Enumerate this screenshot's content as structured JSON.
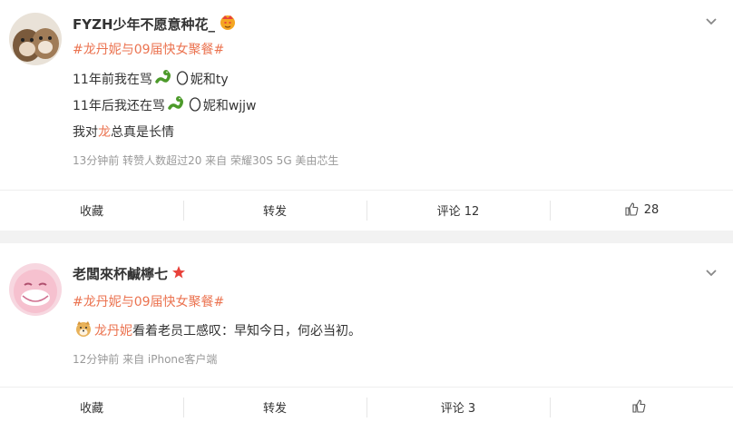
{
  "posts": [
    {
      "username": "FYZH少年不愿意种花_",
      "badge_icon": "crown-emoji-icon",
      "topic": "#龙丹妮与09届快女聚餐#",
      "lines": {
        "l1_a": "11年前我在骂",
        "l1_b": "妮和ty",
        "l2_a": "11年后我还在骂",
        "l2_b": "妮和wjjw",
        "l3_a": "我对",
        "l3_hl": "龙",
        "l3_b": "总真是长情"
      },
      "meta": "13分钟前  转赞人数超过20  来自 荣耀30S 5G 美由芯生",
      "actions": {
        "collect": "收藏",
        "repost": "转发",
        "comment": "评论 12",
        "like": "28"
      }
    },
    {
      "username": "老闆來杯鹹檸七",
      "badge_icon": "red-star-icon",
      "topic": "#龙丹妮与09届快女聚餐#",
      "lines": {
        "l1_hl": "龙丹妮",
        "l1_b": "看着老员工感叹：早知今日，何必当初。"
      },
      "meta": "12分钟前  来自 iPhone客户端",
      "actions": {
        "collect": "收藏",
        "repost": "转发",
        "comment": "评论 3",
        "like": ""
      }
    }
  ],
  "colors": {
    "topic": "#eb7350",
    "meta": "#999999",
    "text": "#333333"
  }
}
